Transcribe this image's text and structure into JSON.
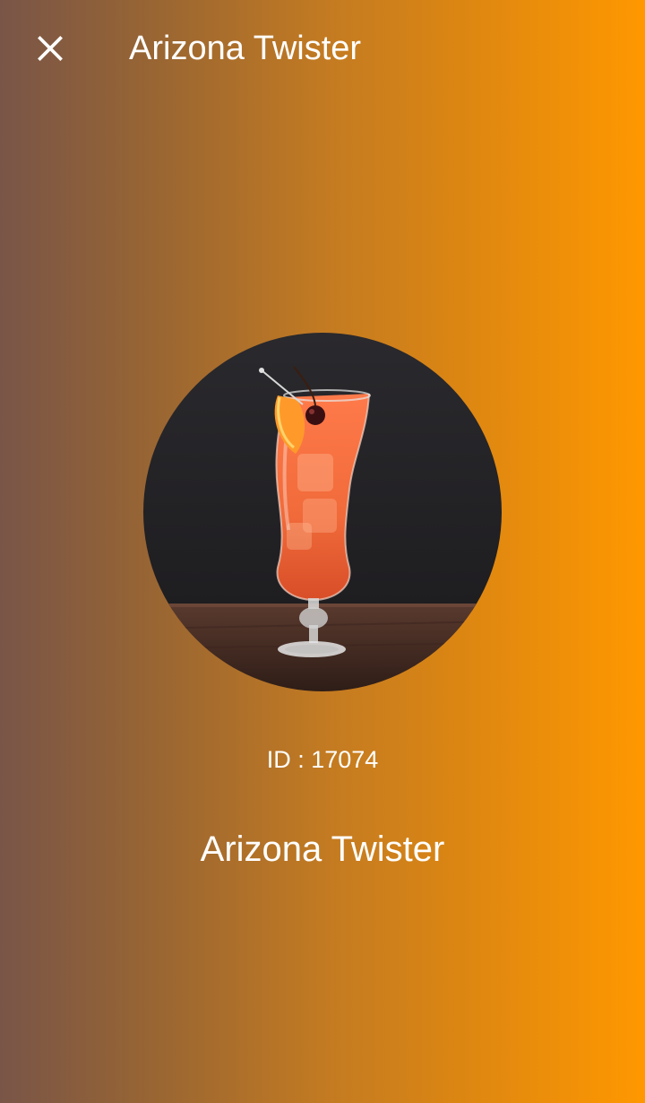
{
  "app_bar": {
    "title": "Arizona Twister",
    "close_icon": "close-icon"
  },
  "drink": {
    "id_label": "ID : 17074",
    "name": "Arizona Twister",
    "image_icon": "cocktail-photo"
  },
  "colors": {
    "gradient_start": "#795548",
    "gradient_end": "#ff9800",
    "text": "#ffffff"
  }
}
